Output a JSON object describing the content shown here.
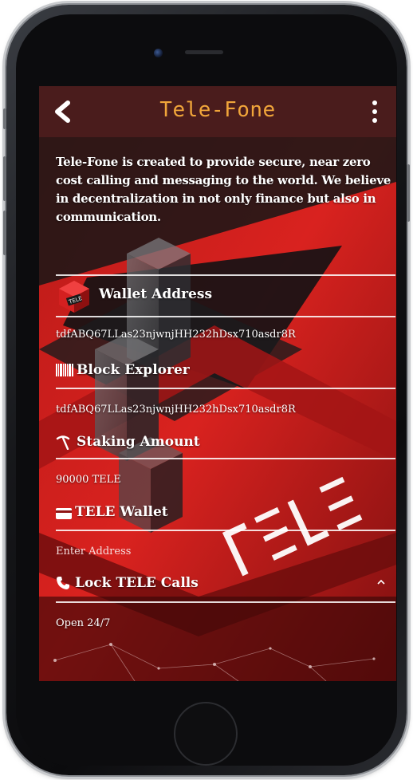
{
  "app": {
    "title": "Tele-Fone",
    "intro": "Tele-Fone is created to provide secure, near zero cost calling and messaging to the world. We believe in decentralization in not only finance but also in communication."
  },
  "sections": {
    "wallet_address": {
      "title": "Wallet Address",
      "value": "tdfABQ67LLas23njwnjHH232hDsx710asdr8R",
      "icon": "tele-cube-logo-icon"
    },
    "block_explorer": {
      "title": "Block Explorer",
      "value": "tdfABQ67LLas23njwnjHH232hDsx710asdr8R",
      "icon": "barcode-icon"
    },
    "staking_amount": {
      "title": "Staking Amount",
      "value": "90000 TELE",
      "icon": "pickaxe-icon"
    },
    "tele_wallet": {
      "title": "TELE Wallet",
      "placeholder": "Enter Address",
      "icon": "credit-card-icon"
    },
    "lock_tele_calls": {
      "title": "Lock TELE Calls",
      "value": "Open 24/7",
      "icon": "phone-icon"
    }
  },
  "background_watermark": "TELE",
  "colors": {
    "appbar": "#4a1c1c",
    "title": "#f0a53a",
    "accent_red": "#d9221f",
    "text": "#ffffff"
  }
}
